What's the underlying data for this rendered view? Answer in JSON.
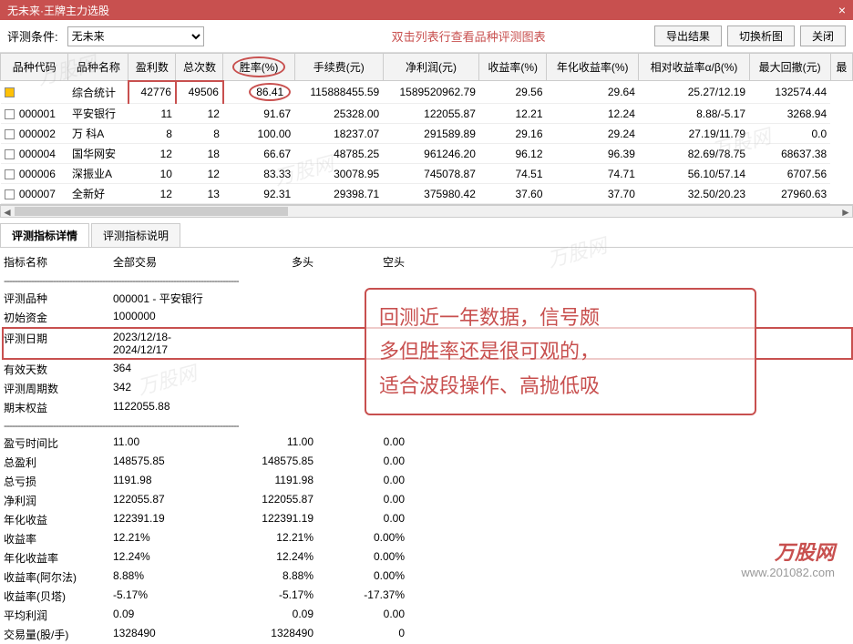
{
  "window": {
    "title": "无未来·王牌主力选股",
    "close": "×"
  },
  "toolbar": {
    "condition_label": "评测条件:",
    "condition_value": "无未来",
    "hint": "双击列表行查看品种评测图表",
    "export_btn": "导出结果",
    "switch_btn": "切换析图",
    "close_btn": "关闭"
  },
  "grid": {
    "headers": [
      "品种代码",
      "品种名称",
      "盈利数",
      "总次数",
      "胜率(%)",
      "手续费(元)",
      "净利润(元)",
      "收益率(%)",
      "年化收益率(%)",
      "相对收益率α/β(%)",
      "最大回撤(元)",
      "最"
    ],
    "rows": [
      {
        "checked": true,
        "code": "",
        "name": "综合统计",
        "win": "42776",
        "total": "49506",
        "rate": "86.41",
        "fee": "115888455.59",
        "profit": "1589520962.79",
        "ret": "29.56",
        "annual": "29.64",
        "rel": "25.27/12.19",
        "dd": "132574.44"
      },
      {
        "checked": false,
        "code": "000001",
        "name": "平安银行",
        "win": "11",
        "total": "12",
        "rate": "91.67",
        "fee": "25328.00",
        "profit": "122055.87",
        "ret": "12.21",
        "annual": "12.24",
        "rel": "8.88/-5.17",
        "dd": "3268.94"
      },
      {
        "checked": false,
        "code": "000002",
        "name": "万 科A",
        "win": "8",
        "total": "8",
        "rate": "100.00",
        "fee": "18237.07",
        "profit": "291589.89",
        "ret": "29.16",
        "annual": "29.24",
        "rel": "27.19/11.79",
        "dd": "0.0"
      },
      {
        "checked": false,
        "code": "000004",
        "name": "国华网安",
        "win": "12",
        "total": "18",
        "rate": "66.67",
        "fee": "48785.25",
        "profit": "961246.20",
        "ret": "96.12",
        "annual": "96.39",
        "rel": "82.69/78.75",
        "dd": "68637.38"
      },
      {
        "checked": false,
        "code": "000006",
        "name": "深振业A",
        "win": "10",
        "total": "12",
        "rate": "83.33",
        "fee": "30078.95",
        "profit": "745078.87",
        "ret": "74.51",
        "annual": "74.71",
        "rel": "56.10/57.14",
        "dd": "6707.56"
      },
      {
        "checked": false,
        "code": "000007",
        "name": "全新好",
        "win": "12",
        "total": "13",
        "rate": "92.31",
        "fee": "29398.71",
        "profit": "375980.42",
        "ret": "37.60",
        "annual": "37.70",
        "rel": "32.50/20.23",
        "dd": "27960.63"
      }
    ]
  },
  "tabs": {
    "detail": "评测指标详情",
    "desc": "评测指标说明"
  },
  "details": {
    "header": {
      "name": "指标名称",
      "all": "全部交易",
      "long": "多头",
      "short": "空头"
    },
    "rows": [
      {
        "k": "评测品种",
        "v1": "000001 - 平安银行",
        "v2": "",
        "v3": ""
      },
      {
        "k": "初始资金",
        "v1": "1000000",
        "v2": "",
        "v3": ""
      },
      {
        "k": "评测日期",
        "v1": "2023/12/18-2024/12/17",
        "v2": "",
        "v3": "",
        "hl": true
      },
      {
        "k": "有效天数",
        "v1": "364",
        "v2": "",
        "v3": ""
      },
      {
        "k": "评测周期数",
        "v1": "342",
        "v2": "",
        "v3": ""
      },
      {
        "k": "期末权益",
        "v1": "1122055.88",
        "v2": "",
        "v3": ""
      },
      {
        "k": "盈亏时间比",
        "v1": "11.00",
        "v2": "11.00",
        "v3": "0.00"
      },
      {
        "k": "总盈利",
        "v1": "148575.85",
        "v2": "148575.85",
        "v3": "0.00"
      },
      {
        "k": "总亏损",
        "v1": "1191.98",
        "v2": "1191.98",
        "v3": "0.00"
      },
      {
        "k": "净利润",
        "v1": "122055.87",
        "v2": "122055.87",
        "v3": "0.00"
      },
      {
        "k": "年化收益",
        "v1": "122391.19",
        "v2": "122391.19",
        "v3": "0.00"
      },
      {
        "k": "收益率",
        "v1": "12.21%",
        "v2": "12.21%",
        "v3": "0.00%"
      },
      {
        "k": "年化收益率",
        "v1": "12.24%",
        "v2": "12.24%",
        "v3": "0.00%"
      },
      {
        "k": "收益率(阿尔法)",
        "v1": "8.88%",
        "v2": "8.88%",
        "v3": "0.00%"
      },
      {
        "k": "收益率(贝塔)",
        "v1": "-5.17%",
        "v2": "-5.17%",
        "v3": "-17.37%"
      },
      {
        "k": "平均利润",
        "v1": "0.09",
        "v2": "0.09",
        "v3": "0.00"
      },
      {
        "k": "交易量(股/手)",
        "v1": "1328490",
        "v2": "1328490",
        "v3": "0"
      }
    ]
  },
  "annotation": {
    "l1": "回测近一年数据，信号颇",
    "l2": "多但胜率还是很可观的，",
    "l3": "适合波段操作、高抛低吸"
  },
  "watermark": "万股网",
  "logo": {
    "brand": "万股网",
    "url": "www.201082.com"
  }
}
